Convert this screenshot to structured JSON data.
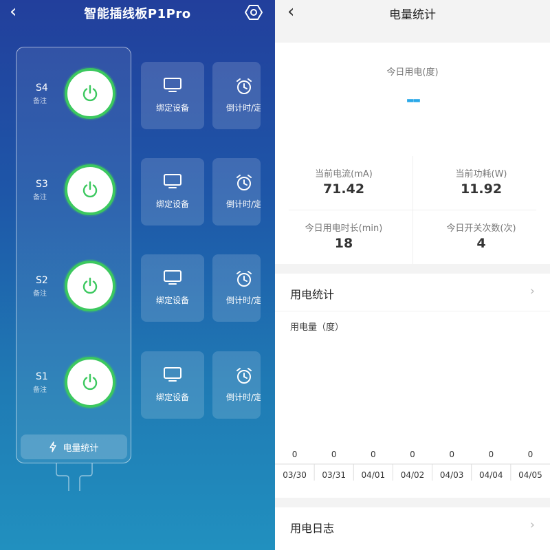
{
  "left": {
    "title": "智能插线板P1Pro",
    "sockets": [
      {
        "name": "S4",
        "note": "备注",
        "bind_label": "绑定设备",
        "timer_label": "倒计时/定"
      },
      {
        "name": "S3",
        "note": "备注",
        "bind_label": "绑定设备",
        "timer_label": "倒计时/定"
      },
      {
        "name": "S2",
        "note": "备注",
        "bind_label": "绑定设备",
        "timer_label": "倒计时/定"
      },
      {
        "name": "S1",
        "note": "备注",
        "bind_label": "绑定设备",
        "timer_label": "倒计时/定"
      }
    ],
    "stats_button": "电量统计",
    "icons": {
      "back": "back-arrow-icon",
      "settings": "gear-icon",
      "power": "power-icon",
      "bind": "monitor-icon",
      "timer": "alarm-clock-icon",
      "stats": "lightning-icon"
    },
    "colors": {
      "power_on": "#3cc85f",
      "bg_top": "#223f9c",
      "bg_bottom": "#2190bf"
    }
  },
  "right": {
    "title": "电量统计",
    "today_label": "今日用电(度)",
    "today_value": "--",
    "metrics": [
      {
        "label": "当前电流(mA)",
        "value": "71.42"
      },
      {
        "label": "当前功耗(W)",
        "value": "11.92"
      },
      {
        "label": "今日用电时长(min)",
        "value": "18"
      },
      {
        "label": "今日开关次数(次)",
        "value": "4"
      }
    ],
    "usage_section": "用电统计",
    "log_section": "用电日志",
    "colors": {
      "accent": "#2aa8e8"
    }
  },
  "chart_data": {
    "type": "bar",
    "ylabel": "用电量（度）",
    "categories": [
      "03/30",
      "03/31",
      "04/01",
      "04/02",
      "04/03",
      "04/04",
      "04/05"
    ],
    "values": [
      0,
      0,
      0,
      0,
      0,
      0,
      0
    ]
  }
}
